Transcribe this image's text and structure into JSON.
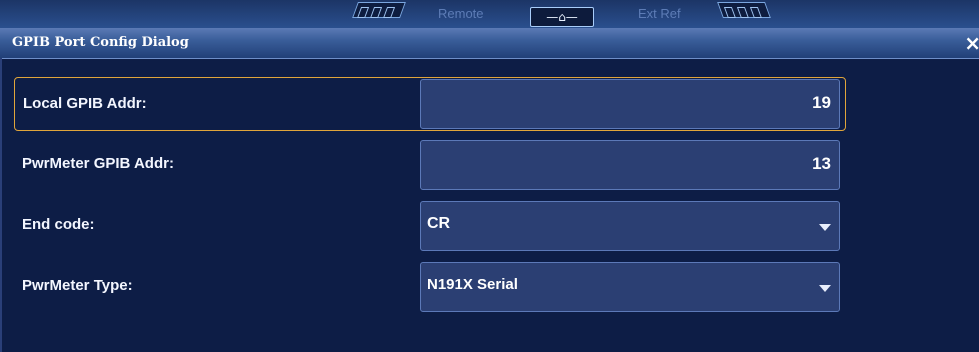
{
  "topbar": {
    "remote_label": "Remote",
    "home_label": "—⌂—",
    "extref_label": "Ext Ref"
  },
  "dialog": {
    "title": "GPIB Port Config Dialog",
    "close_glyph": "×"
  },
  "fields": {
    "local_addr": {
      "label": "Local GPIB Addr:",
      "value": "19"
    },
    "pwrmeter_addr": {
      "label": "PwrMeter GPIB Addr:",
      "value": "13"
    },
    "end_code": {
      "label": "End code:",
      "value": "CR"
    },
    "pwrmeter_type": {
      "label": "PwrMeter Type:",
      "value": "N191X Serial"
    }
  },
  "colors": {
    "background": "#0d1d46",
    "field_bg": "#2b3f73",
    "focus_border": "#e0a53b"
  }
}
